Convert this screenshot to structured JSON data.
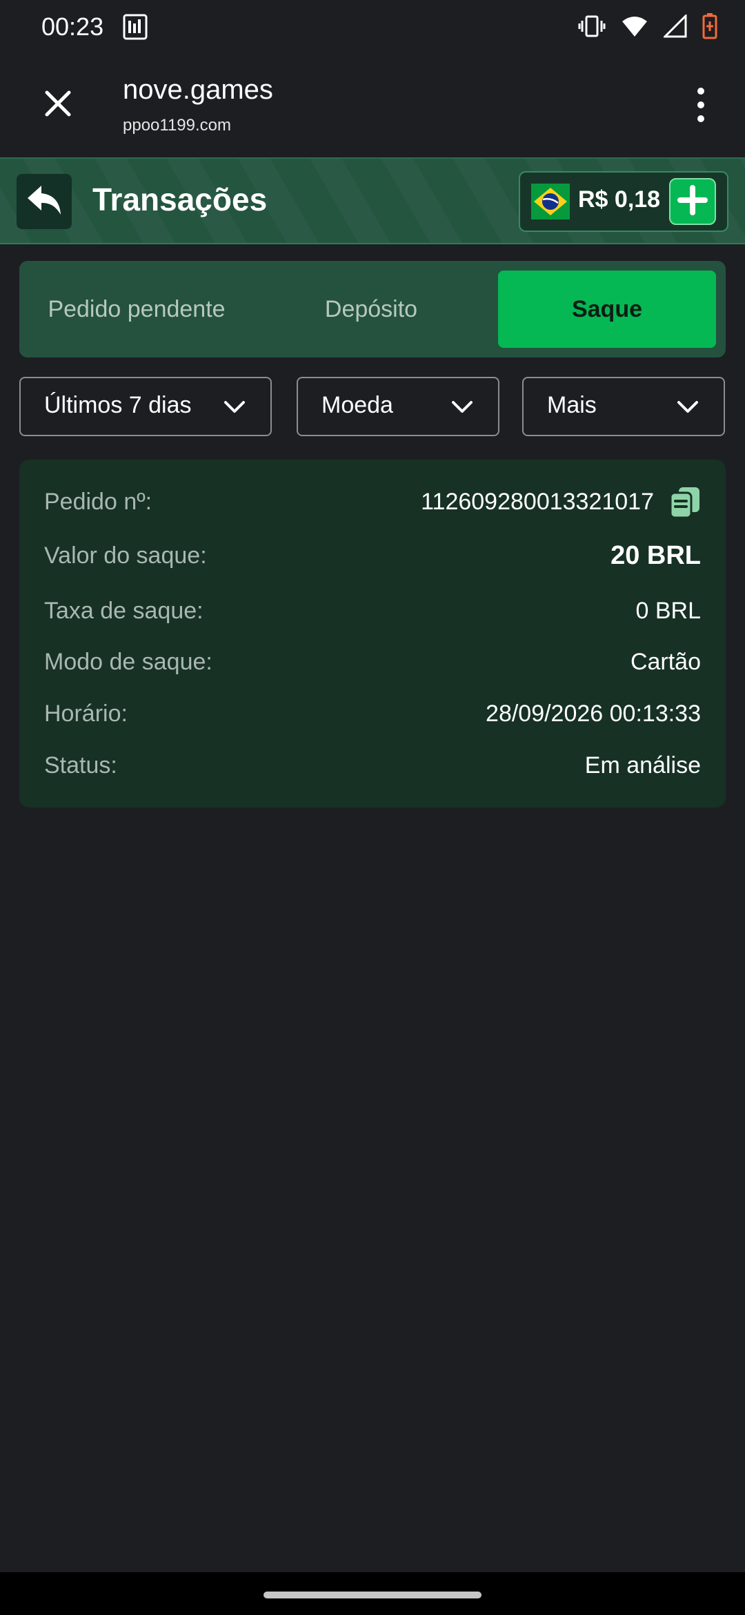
{
  "status_bar": {
    "time": "00:23",
    "icons": [
      "notification-image-icon",
      "vibrate-icon",
      "wifi-icon",
      "signal-icon",
      "battery-low-icon"
    ]
  },
  "browser": {
    "title": "nove.games",
    "url": "ppoo1199.com",
    "icons": [
      "close-icon",
      "more-vert-icon"
    ]
  },
  "header": {
    "title": "Transações",
    "balance": "R$ 0,18",
    "icons": [
      "back-arrow-icon",
      "brazil-flag-icon",
      "plus-icon"
    ]
  },
  "tabs": [
    {
      "label": "Pedido pendente",
      "active": false
    },
    {
      "label": "Depósito",
      "active": false
    },
    {
      "label": "Saque",
      "active": true
    }
  ],
  "filters": [
    {
      "label": "Últimos 7 dias"
    },
    {
      "label": "Moeda"
    },
    {
      "label": "Mais"
    }
  ],
  "transaction": {
    "order_label": "Pedido nº:",
    "order_value": "112609280013321017",
    "amount_label": "Valor do saque:",
    "amount_value": "20 BRL",
    "fee_label": "Taxa de saque:",
    "fee_value": "0 BRL",
    "mode_label": "Modo de saque:",
    "mode_value": "Cartão",
    "time_label": "Horário:",
    "time_value": "28/09/2026 00:13:33",
    "status_label": "Status:",
    "status_value": "Em análise"
  },
  "colors": {
    "background": "#1d1e22",
    "header": "#23553f",
    "accent_green": "#05b853",
    "card": "#173125",
    "label_gray": "#a9b8b1"
  }
}
